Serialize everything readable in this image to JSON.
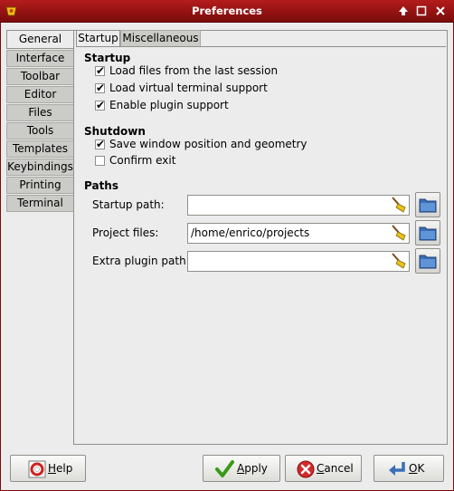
{
  "window": {
    "title": "Preferences"
  },
  "vtabs": [
    "General",
    "Interface",
    "Toolbar",
    "Editor",
    "Files",
    "Tools",
    "Templates",
    "Keybindings",
    "Printing",
    "Terminal"
  ],
  "htabs": [
    "Startup",
    "Miscellaneous"
  ],
  "startup": {
    "title": "Startup",
    "options": [
      {
        "label": "Load files from the last session",
        "checked": true
      },
      {
        "label": "Load virtual terminal support",
        "checked": true
      },
      {
        "label": "Enable plugin support",
        "checked": true
      }
    ]
  },
  "shutdown": {
    "title": "Shutdown",
    "options": [
      {
        "label": "Save window position and geometry",
        "checked": true
      },
      {
        "label": "Confirm exit",
        "checked": false
      }
    ]
  },
  "paths": {
    "title": "Paths",
    "rows": [
      {
        "label": "Startup path:",
        "value": ""
      },
      {
        "label": "Project files:",
        "value": "/home/enrico/projects"
      },
      {
        "label": "Extra plugin path:",
        "value": ""
      }
    ]
  },
  "buttons": {
    "help": {
      "mnemonic": "H",
      "rest": "elp"
    },
    "apply": {
      "mnemonic": "A",
      "rest": "pply"
    },
    "cancel": {
      "mnemonic": "C",
      "rest": "ancel"
    },
    "ok": {
      "mnemonic": "O",
      "rest": "K"
    }
  },
  "colors": {
    "titlebar": "#9a1414",
    "accent_blue": "#3a6fb8"
  }
}
